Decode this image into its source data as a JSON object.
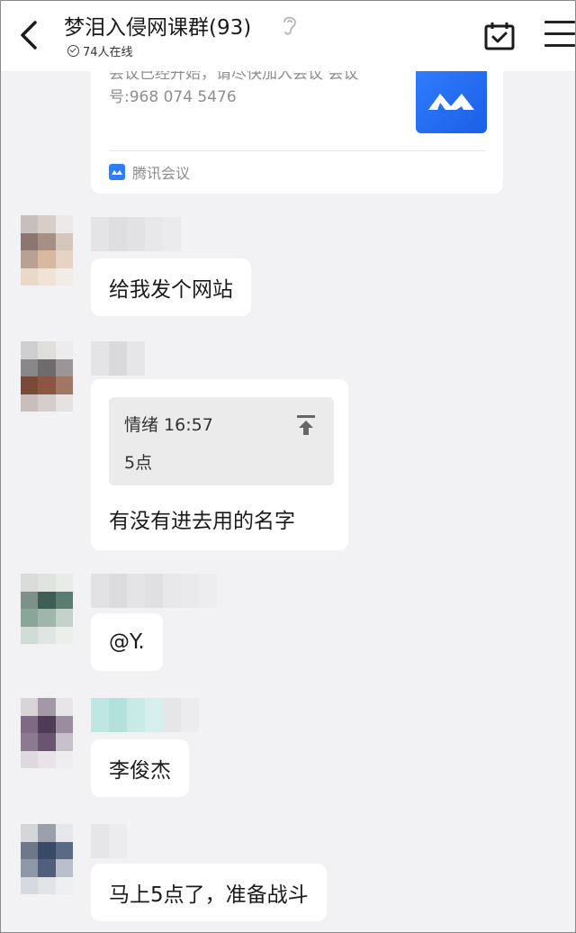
{
  "header": {
    "title": "梦泪入侵网课群(93)",
    "online": "74人在线",
    "icons": [
      "back-icon",
      "ear-icon",
      "calendar-check-icon",
      "menu-icon"
    ]
  },
  "meeting_card": {
    "text": "会议已经开始，请尽快加入会议 会议号:968 074 5476",
    "source": "腾讯会议"
  },
  "messages": [
    {
      "text": "给我发个网站"
    },
    {
      "quote": {
        "author_time": "情绪 16:57",
        "content": "5点"
      },
      "text": "有没有进去用的名字"
    },
    {
      "text": "@Y."
    },
    {
      "text": "李俊杰"
    },
    {
      "text": "马上5点了，准备战斗"
    }
  ],
  "colors": {
    "accent": "#2f7dff",
    "background": "#f2f2f4",
    "bubble": "#ffffff"
  }
}
